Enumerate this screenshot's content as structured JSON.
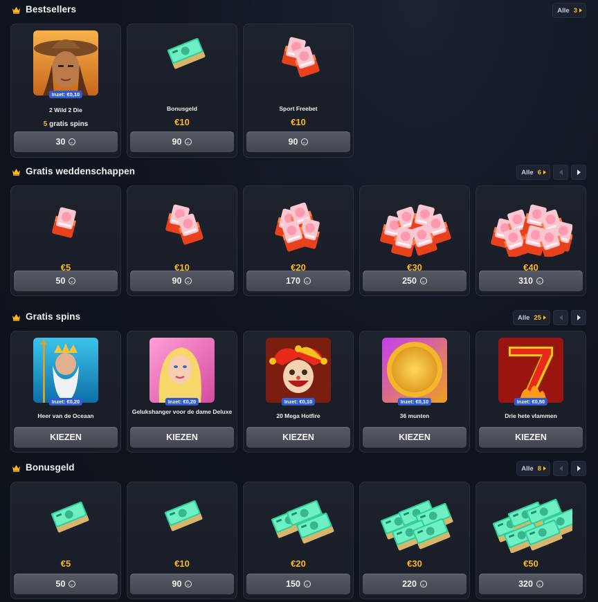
{
  "colors": {
    "accent_gold": "#ffb81c",
    "inzet_badge": "#2f5bd6",
    "button": "#4d515c",
    "card": "#1b1f29"
  },
  "icons": {
    "section": "crown-icon",
    "button": "coin-smiley-icon"
  },
  "sections": [
    {
      "title": "Bestsellers",
      "alle_label": "Alle",
      "count": "3",
      "show_arrows": false,
      "cards": [
        {
          "kind": "game",
          "name": "2 Wild 2 Die",
          "inzet": "Inzet: €0,10",
          "spins_num": "5",
          "spins_text": " gratis spins",
          "button": "30",
          "image": "cowboy"
        },
        {
          "kind": "product",
          "name": "Bonusgeld",
          "price": "€10",
          "button": "90",
          "image": "cash"
        },
        {
          "kind": "product",
          "name": "Sport Freebet",
          "price": "€10",
          "button": "90",
          "image": "ticket"
        }
      ]
    },
    {
      "title": "Gratis weddenschappen",
      "alle_label": "Alle",
      "count": "6",
      "show_arrows": true,
      "cards": [
        {
          "kind": "product",
          "price": "€5",
          "button": "50",
          "image": "ticket"
        },
        {
          "kind": "product",
          "price": "€10",
          "button": "90",
          "image": "ticket"
        },
        {
          "kind": "product",
          "price": "€20",
          "button": "170",
          "image": "ticket"
        },
        {
          "kind": "product",
          "price": "€30",
          "button": "250",
          "image": "ticket"
        },
        {
          "kind": "product",
          "price": "€40",
          "button": "310",
          "image": "ticket"
        }
      ]
    },
    {
      "title": "Gratis spins",
      "alle_label": "Alle",
      "count": "25",
      "show_arrows": true,
      "cards": [
        {
          "kind": "spin",
          "name": "Heer van de Oceaan",
          "inzet": "Inzet: €0,20",
          "button": "KIEZEN",
          "image": "ocean"
        },
        {
          "kind": "spin",
          "name": "Gelukshanger voor de dame Deluxe",
          "inzet": "Inzet: €0,20",
          "button": "KIEZEN",
          "image": "lady"
        },
        {
          "kind": "spin",
          "name": "20 Mega Hotfire",
          "inzet": "Inzet: €0,10",
          "button": "KIEZEN",
          "image": "joker"
        },
        {
          "kind": "spin",
          "name": "36 munten",
          "inzet": "Inzet: €0,10",
          "button": "KIEZEN",
          "image": "coin"
        },
        {
          "kind": "spin",
          "name": "Drie hete vlammen",
          "inzet": "Inzet: €0,50",
          "button": "KIEZEN",
          "image": "seven"
        }
      ]
    },
    {
      "title": "Bonusgeld",
      "alle_label": "Alle",
      "count": "8",
      "show_arrows": true,
      "cards": [
        {
          "kind": "product",
          "price": "€5",
          "button": "50",
          "image": "cash"
        },
        {
          "kind": "product",
          "price": "€10",
          "button": "90",
          "image": "cash"
        },
        {
          "kind": "product",
          "price": "€20",
          "button": "150",
          "image": "cash"
        },
        {
          "kind": "product",
          "price": "€30",
          "button": "220",
          "image": "cash"
        },
        {
          "kind": "product",
          "price": "€50",
          "button": "320",
          "image": "cash"
        }
      ]
    }
  ]
}
